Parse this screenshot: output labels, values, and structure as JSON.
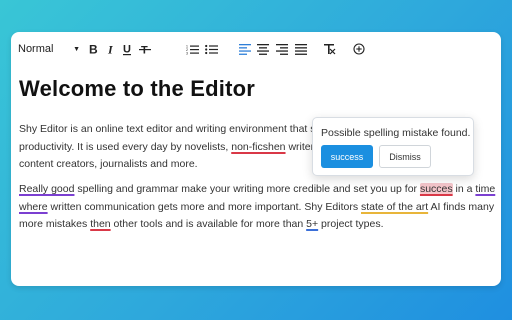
{
  "toolbar": {
    "format_select": "Normal",
    "buttons": [
      "bold",
      "italic",
      "underline",
      "strikethrough",
      "ordered-list",
      "bullet-list",
      "align-left",
      "align-center",
      "align-right",
      "align-justify",
      "clear-formatting",
      "add"
    ]
  },
  "editor": {
    "heading": "Welcome to the Editor",
    "p1": {
      "l1": "Shy Editor is an online text editor and writing environment that s",
      "l2_a": "productivity. It is used every day by novelists, ",
      "l2_err": "non-ficshen",
      "l2_b": " writer",
      "l3": "content creators, journalists and more."
    },
    "p2": {
      "l1_err1": "Really good",
      "l1_a": " spelling and grammar make your writing more credible and set you up for ",
      "l1_err2": "succes",
      "l1_b": " in a ",
      "l1_err3": "time",
      "l2_err1": "where",
      "l2_a": " written communication gets more and more important. Shy Editors ",
      "l2_err2": "state of the art",
      "l2_b": " AI finds many",
      "l3_a": "more mistakes ",
      "l3_err1": "then",
      "l3_b": " other tools and is available for more than ",
      "l3_err2": "5+",
      "l3_c": " project types."
    }
  },
  "popup": {
    "message": "Possible spelling mistake found.",
    "suggestion": "success",
    "dismiss": "Dismiss"
  },
  "colors": {
    "accent": "#1b8fe0",
    "spelling": "#d93847",
    "style": "#7b3fd1",
    "grammar": "#e8b53a",
    "align_active": "#2f7fd8"
  }
}
